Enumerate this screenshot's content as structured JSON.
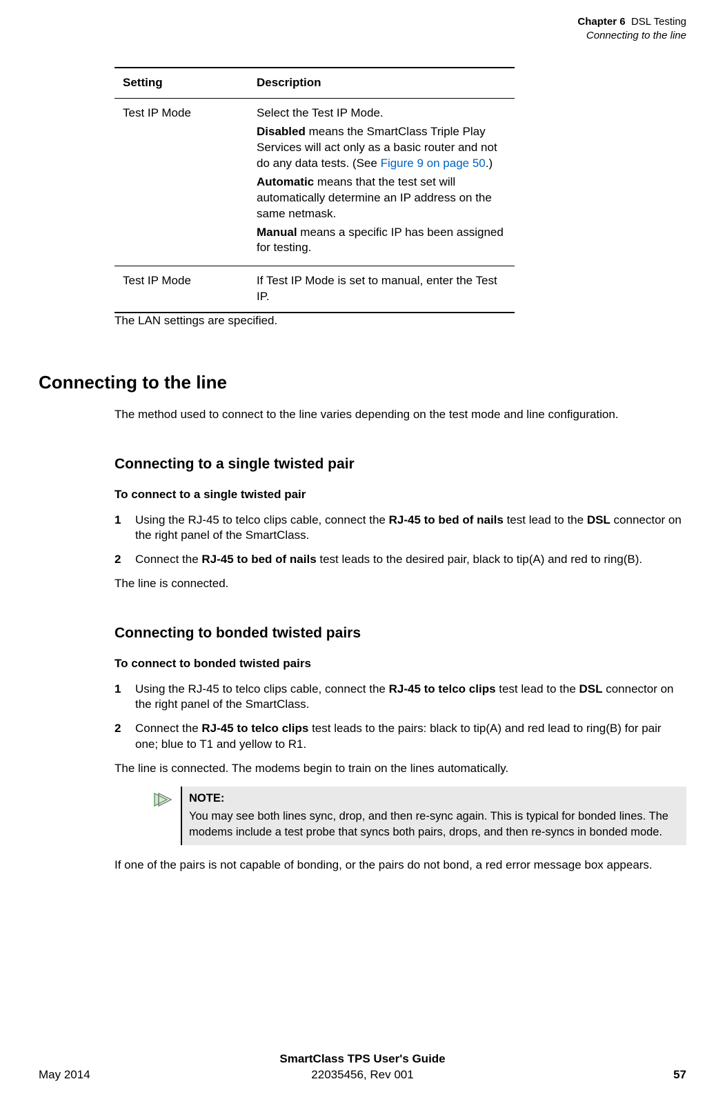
{
  "header": {
    "chapter_label": "Chapter 6",
    "chapter_title": "DSL Testing",
    "section_title": "Connecting to the line"
  },
  "table": {
    "headers": {
      "col1": "Setting",
      "col2": "Description"
    },
    "rows": [
      {
        "setting": "Test IP Mode",
        "desc_intro": "Select the Test IP Mode.",
        "desc_disabled_label": "Disabled",
        "desc_disabled_text": " means the SmartClass Triple Play Services will act only as a basic router and not do any data tests. (See ",
        "desc_disabled_link": "Figure 9 on page 50",
        "desc_disabled_tail": ".)",
        "desc_auto_label": "Automatic",
        "desc_auto_text": " means that the test set will automatically determine an IP address on the same netmask.",
        "desc_manual_label": "Manual",
        "desc_manual_text": " means a specific IP has been assigned for testing."
      },
      {
        "setting": "Test IP Mode",
        "desc_plain": "If Test IP Mode is set to manual, enter the Test IP."
      }
    ]
  },
  "after_table_text": "The LAN settings are specified.",
  "h1_text": "Connecting to the line",
  "intro_text": "The method used to connect to the line varies depending on the test mode and line configuration.",
  "section_a": {
    "h2": "Connecting to a single twisted pair",
    "h3": "To connect to a single twisted pair",
    "steps": [
      {
        "num": "1",
        "pre1": "Using the RJ-45 to telco clips cable, connect the ",
        "b1": "RJ-45 to bed of nails",
        "mid1": " test lead to the ",
        "b2": "DSL",
        "post1": " connector on the right panel of the SmartClass."
      },
      {
        "num": "2",
        "pre1": "Connect the ",
        "b1": "RJ-45 to bed of nails",
        "post1": " test leads to the desired pair, black to tip(A) and red to ring(B)."
      }
    ],
    "closing": "The line is connected."
  },
  "section_b": {
    "h2": "Connecting to bonded twisted pairs",
    "h3": "To connect to bonded twisted pairs",
    "steps": [
      {
        "num": "1",
        "pre1": "Using the RJ-45 to telco clips cable, connect the ",
        "b1": "RJ-45 to telco clips",
        "mid1": " test lead to the ",
        "b2": "DSL",
        "post1": " connector on the right panel of the SmartClass."
      },
      {
        "num": "2",
        "pre1": "Connect the ",
        "b1": "RJ-45 to telco clips",
        "post1": " test leads to the pairs: black to tip(A) and red lead to ring(B) for pair one; blue to T1 and yellow to R1."
      }
    ],
    "closing": "The line is connected. The modems begin to train on the lines automatically.",
    "note_title": "NOTE:",
    "note_body": "You may see both lines sync, drop, and then re-sync again. This is typical for bonded lines. The modems include a test probe that syncs both pairs, drops, and then re-syncs in bonded mode.",
    "after_note": "If one of the pairs is not capable of bonding, or the pairs do not bond, a red error message box appears."
  },
  "footer": {
    "left": "May 2014",
    "center_title": "SmartClass TPS User's Guide",
    "center_sub": "22035456, Rev 001",
    "right": "57"
  }
}
